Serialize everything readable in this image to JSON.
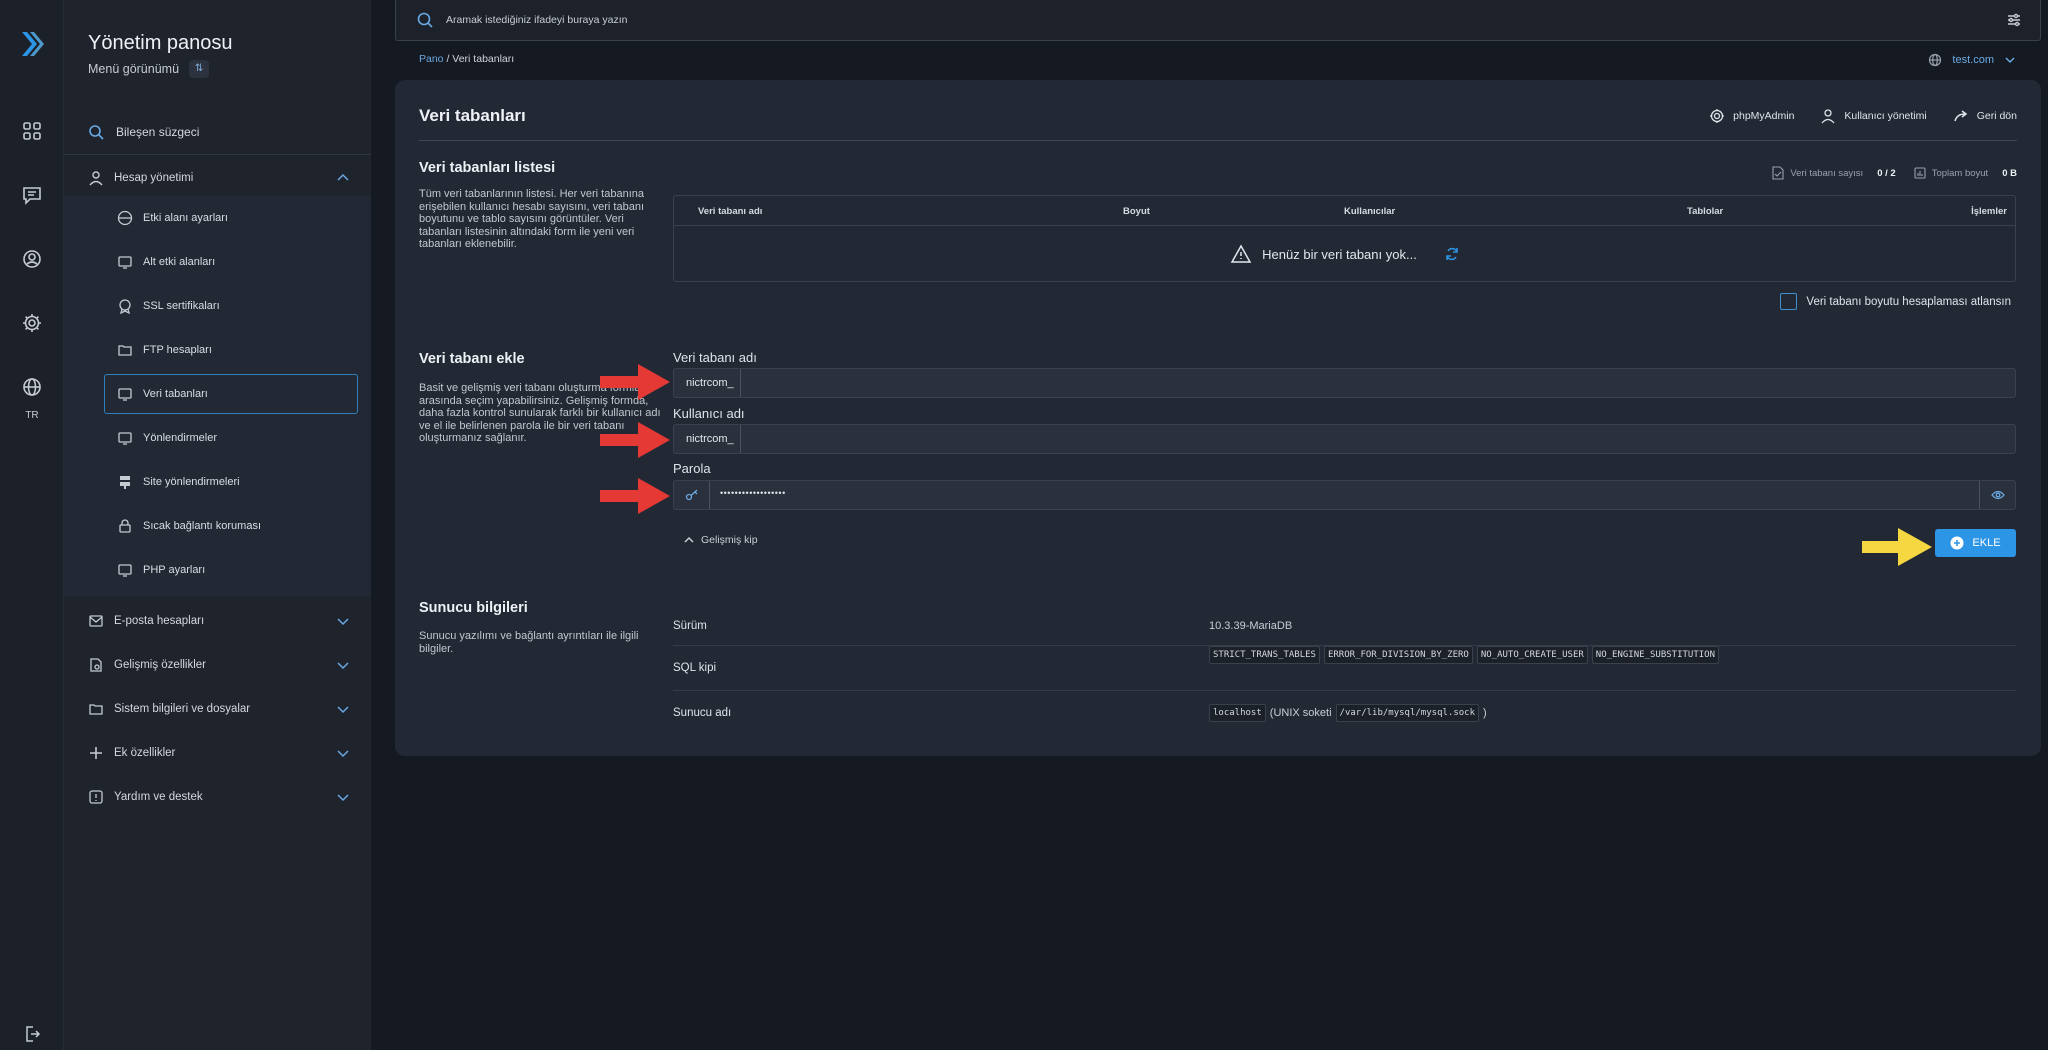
{
  "colors": {
    "accent": "#2d95e6",
    "background": "#151a22",
    "card": "#232934",
    "sidebar": "#1e232c",
    "arrow_red": "#e53935",
    "arrow_yellow": "#f5d742"
  },
  "rail": {
    "lang": "TR",
    "icons": [
      "logo-icon",
      "grid-icon",
      "chat-icon",
      "user-circle-icon",
      "gear-icon",
      "globe-icon",
      "logout-icon"
    ]
  },
  "sidebar": {
    "title": "Yönetim panosu",
    "subtitle": "Menü görünümü",
    "search_label": "Bileşen süzgeci",
    "account": "Hesap yönetimi",
    "sub_items": [
      "Etki alanı ayarları",
      "Alt etki alanları",
      "SSL sertifikaları",
      "FTP hesapları",
      "Veri tabanları",
      "Yönlendirmeler",
      "Site yönlendirmeleri",
      "Sıcak bağlantı koruması",
      "PHP ayarları"
    ],
    "groups": [
      "E-posta hesapları",
      "Gelişmiş özellikler",
      "Sistem bilgileri ve dosyalar",
      "Ek özellikler",
      "Yardım ve destek"
    ]
  },
  "topbar": {
    "search_placeholder": "Aramak istediğiniz ifadeyi buraya yazın"
  },
  "breadcrumb": {
    "home": "Pano",
    "sep": "/",
    "current": "Veri tabanları"
  },
  "domain": "test.com",
  "page": {
    "title": "Veri tabanları",
    "actions": {
      "phpmyadmin": "phpMyAdmin",
      "users": "Kullanıcı yönetimi",
      "back": "Geri dön"
    }
  },
  "list": {
    "title": "Veri tabanları listesi",
    "desc": "Tüm veri tabanlarının listesi. Her veri tabanına erişebilen kullanıcı hesabı sayısını, veri tabanı boyutunu ve tablo sayısını görüntüler. Veri tabanları listesinin altındaki form ile yeni veri tabanları eklenebilir.",
    "count_label": "Veri tabanı sayısı",
    "count_value": "0 / 2",
    "size_label": "Toplam boyut",
    "size_value": "0 B",
    "columns": [
      "Veri tabanı adı",
      "Boyut",
      "Kullanıcılar",
      "Tablolar",
      "İşlemler"
    ],
    "empty": "Henüz bir veri tabanı yok...",
    "skip_size": "Veri tabanı boyutu hesaplaması atlansın"
  },
  "add": {
    "title": "Veri tabanı ekle",
    "desc": "Basit ve gelişmiş veri tabanı oluşturma formları arasında seçim yapabilirsiniz. Gelişmiş formda, daha fazla kontrol sunularak farklı bir kullanıcı adı ve el ile belirlenen parola ile bir veri tabanı oluşturmanız sağlanır.",
    "db_label": "Veri tabanı adı",
    "db_prefix": "nictrcom_",
    "user_label": "Kullanıcı adı",
    "user_prefix": "nictrcom_",
    "pass_label": "Parola",
    "pass_value": "••••••••••••••••••",
    "advanced": "Gelişmiş kip",
    "submit": "EKLE"
  },
  "server": {
    "title": "Sunucu bilgileri",
    "desc": "Sunucu yazılımı ve bağlantı ayrıntıları ile ilgili bilgiler.",
    "version_label": "Sürüm",
    "version_value": "10.3.39-MariaDB",
    "sql_label": "SQL kipi",
    "sql_modes": [
      "STRICT_TRANS_TABLES",
      "ERROR_FOR_DIVISION_BY_ZERO",
      "NO_AUTO_CREATE_USER",
      "NO_ENGINE_SUBSTITUTION"
    ],
    "host_label": "Sunucu adı",
    "host_value": "localhost",
    "host_socket_pre": "(UNIX soketi",
    "host_socket_path": "/var/lib/mysql/mysql.sock",
    "host_socket_post": ")"
  }
}
